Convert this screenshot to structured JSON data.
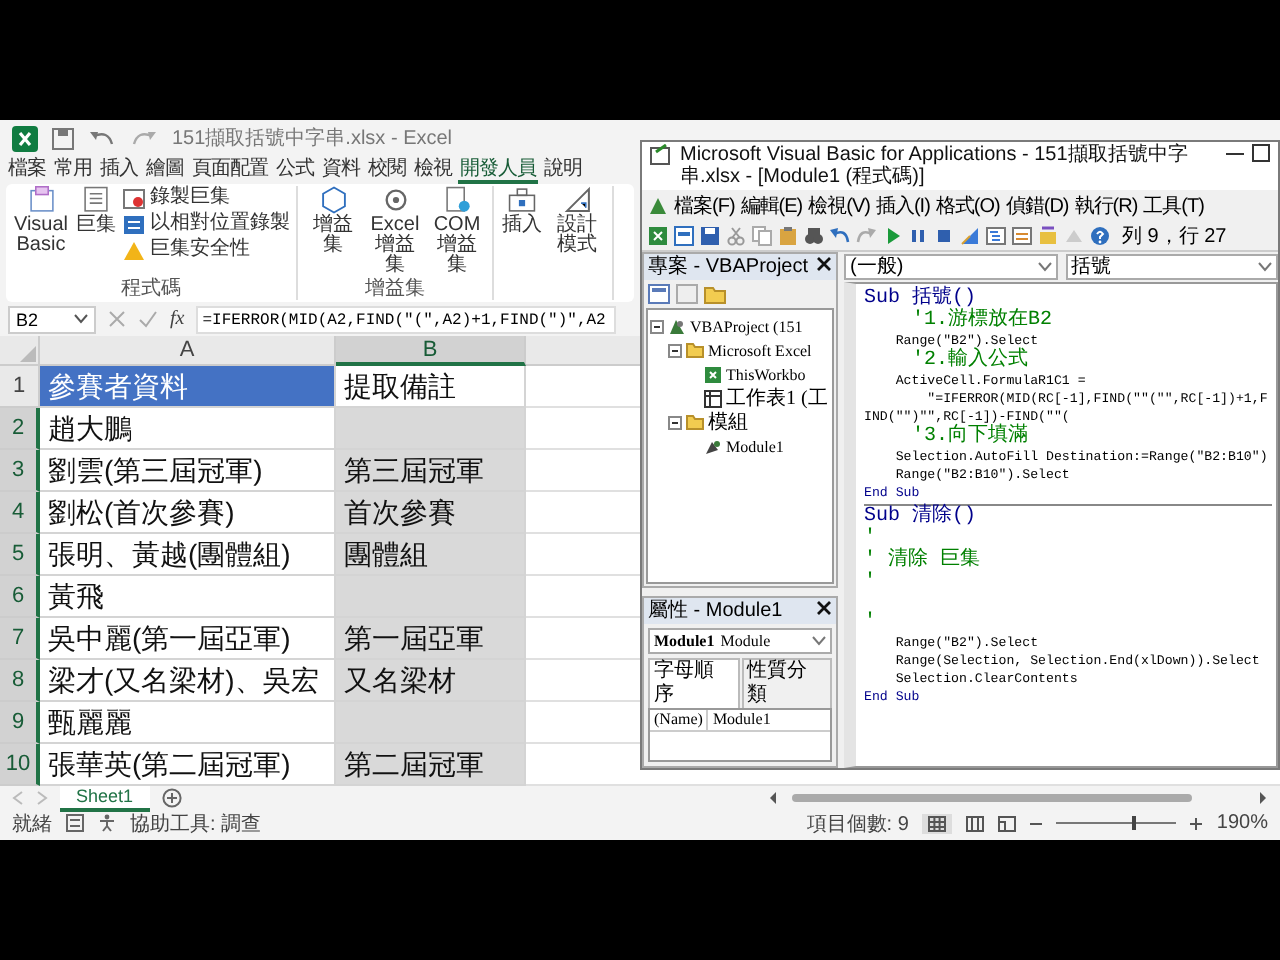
{
  "excel": {
    "title": "151擷取括號中字串.xlsx - Excel",
    "ribbon_tabs": [
      {
        "label": "檔案",
        "selected": false
      },
      {
        "label": "常用",
        "selected": false
      },
      {
        "label": "插入",
        "selected": false
      },
      {
        "label": "繪圖",
        "selected": false
      },
      {
        "label": "頁面配置",
        "selected": false
      },
      {
        "label": "公式",
        "selected": false
      },
      {
        "label": "資料",
        "selected": false
      },
      {
        "label": "校閱",
        "selected": false
      },
      {
        "label": "檢視",
        "selected": false
      },
      {
        "label": "開發人員",
        "selected": true
      },
      {
        "label": "說明",
        "selected": false
      }
    ],
    "ribbon_groups": [
      {
        "label": "程式碼",
        "buttons": [
          {
            "label": "Visual Basic",
            "kind": "large"
          },
          {
            "label": "巨集",
            "kind": "large"
          },
          {
            "label": "錄製巨集",
            "kind": "small"
          },
          {
            "label": "以相對位置錄製",
            "kind": "small"
          },
          {
            "label": "巨集安全性",
            "kind": "small"
          }
        ]
      },
      {
        "label": "增益集",
        "buttons": [
          {
            "label": "增益集",
            "kind": "large"
          },
          {
            "label": "Excel 增益集",
            "kind": "large"
          },
          {
            "label": "COM 增益集",
            "kind": "large"
          }
        ]
      },
      {
        "buttons": [
          {
            "label": "插入",
            "kind": "large"
          },
          {
            "label": "設計模式",
            "kind": "large"
          }
        ]
      }
    ],
    "name_box": "B2",
    "function_button": "fx",
    "formula": "=IFERROR(MID(A2,FIND(\"(\",A2)+1,FIND(\")\",A2",
    "columns": [
      {
        "label": "A",
        "selected": false
      },
      {
        "label": "B",
        "selected": true
      }
    ],
    "rows": [
      {
        "number": "1",
        "kind": "header",
        "name": "參賽者資料",
        "note": "提取備註",
        "selected": false
      },
      {
        "number": "2",
        "kind": "data",
        "name": "趙大鵬",
        "selected": true
      },
      {
        "number": "3",
        "kind": "data",
        "name": "劉雲(第三屆冠軍)",
        "note": "第三屆冠軍",
        "selected": true
      },
      {
        "number": "4",
        "kind": "data",
        "name": "劉松(首次參賽)",
        "note": "首次參賽",
        "selected": true
      },
      {
        "number": "5",
        "kind": "data",
        "name": "張明、黃越(團體組)",
        "note": "團體組",
        "selected": true
      },
      {
        "number": "6",
        "kind": "data",
        "name": "黃飛",
        "selected": true
      },
      {
        "number": "7",
        "kind": "data",
        "name": "吳中麗(第一屆亞軍)",
        "note": "第一屆亞軍",
        "selected": true
      },
      {
        "number": "8",
        "kind": "data",
        "name": "梁才(又名梁材)、吳宏",
        "note": "又名梁材",
        "selected": true
      },
      {
        "number": "9",
        "kind": "data",
        "name": "甄麗麗",
        "selected": true
      },
      {
        "number": "10",
        "kind": "data",
        "name": "張華英(第二屆冠軍)",
        "note": "第二屆冠軍",
        "selected": true
      }
    ],
    "sheet_tabs": [
      {
        "label": "Sheet1",
        "selected": true
      }
    ],
    "status_bar": {
      "ready": "就緒",
      "accessibility": "協助工具: 調查",
      "count": "項目個數: 9",
      "zoom": "190%",
      "zoom_slider": {
        "level": 0.62
      }
    }
  },
  "vba": {
    "title": "Microsoft Visual Basic for Applications - 151擷取括號中字串.xlsx - [Module1 (程式碼)]",
    "menu": [
      "檔案(F)",
      "編輯(E)",
      "檢視(V)",
      "插入(I)",
      "格式(O)",
      "偵錯(D)",
      "執行(R)",
      "工具(T)"
    ],
    "cursor_position": "列 9，行 27",
    "project": {
      "title": "專案 - VBAProject",
      "tree": [
        {
          "label": "VBAProject (151",
          "kind": "project",
          "expanded": true,
          "children": [
            {
              "label": "Microsoft Excel",
              "kind": "folder",
              "expanded": true,
              "children": [
                {
                  "label": "ThisWorkbo",
                  "kind": "workbook"
                },
                {
                  "label": "工作表1 (工",
                  "kind": "sheet"
                }
              ]
            },
            {
              "label": "模組",
              "kind": "folder",
              "expanded": true,
              "children": [
                {
                  "label": "Module1",
                  "kind": "module"
                }
              ]
            }
          ]
        }
      ]
    },
    "properties": {
      "title": "屬性 - Module1",
      "object": "Module1",
      "object_type": "Module",
      "tabs": [
        {
          "label": "字母順序",
          "selected": true
        },
        {
          "label": "性質分類",
          "selected": false
        }
      ],
      "rows": [
        {
          "name": "(Name)",
          "value": "Module1"
        }
      ]
    },
    "code": {
      "object": "(一般)",
      "procedure": "括號",
      "procedures": [
        {
          "lines": [
            {
              "kind": "sub",
              "text": "Sub 括號()"
            },
            {
              "kind": "comment",
              "text": "    '1.游標放在B2"
            },
            {
              "kind": "code",
              "text": "    Range(\"B2\").Select"
            },
            {
              "kind": "comment",
              "text": "    '2.輸入公式"
            },
            {
              "kind": "code",
              "text": "    ActiveCell.FormulaR1C1 ="
            },
            {
              "kind": "code",
              "text": "        \"=IFERROR(MID(RC[-1],FIND(\"\"(\"\",RC[-1])+1,FIND(\"\")\"\",RC[-1])-FIND(\"\"("
            },
            {
              "kind": "comment",
              "text": "    '3.向下填滿"
            },
            {
              "kind": "code",
              "text": "    Selection.AutoFill Destination:=Range(\"B2:B10\")"
            },
            {
              "kind": "code",
              "text": "    Range(\"B2:B10\").Select"
            },
            {
              "kind": "end",
              "text": "End Sub"
            }
          ]
        },
        {
          "lines": [
            {
              "kind": "sub",
              "text": "Sub 清除()"
            },
            {
              "kind": "comment",
              "text": "'"
            },
            {
              "kind": "comment",
              "text": "' 清除 巨集"
            },
            {
              "kind": "comment",
              "text": "'"
            },
            {
              "kind": "blank"
            },
            {
              "kind": "comment",
              "text": "'"
            },
            {
              "kind": "code",
              "text": "    Range(\"B2\").Select"
            },
            {
              "kind": "code",
              "text": "    Range(Selection, Selection.End(xlDown)).Select"
            },
            {
              "kind": "code",
              "text": "    Selection.ClearContents"
            },
            {
              "kind": "end",
              "text": "End Sub"
            }
          ]
        }
      ]
    }
  }
}
